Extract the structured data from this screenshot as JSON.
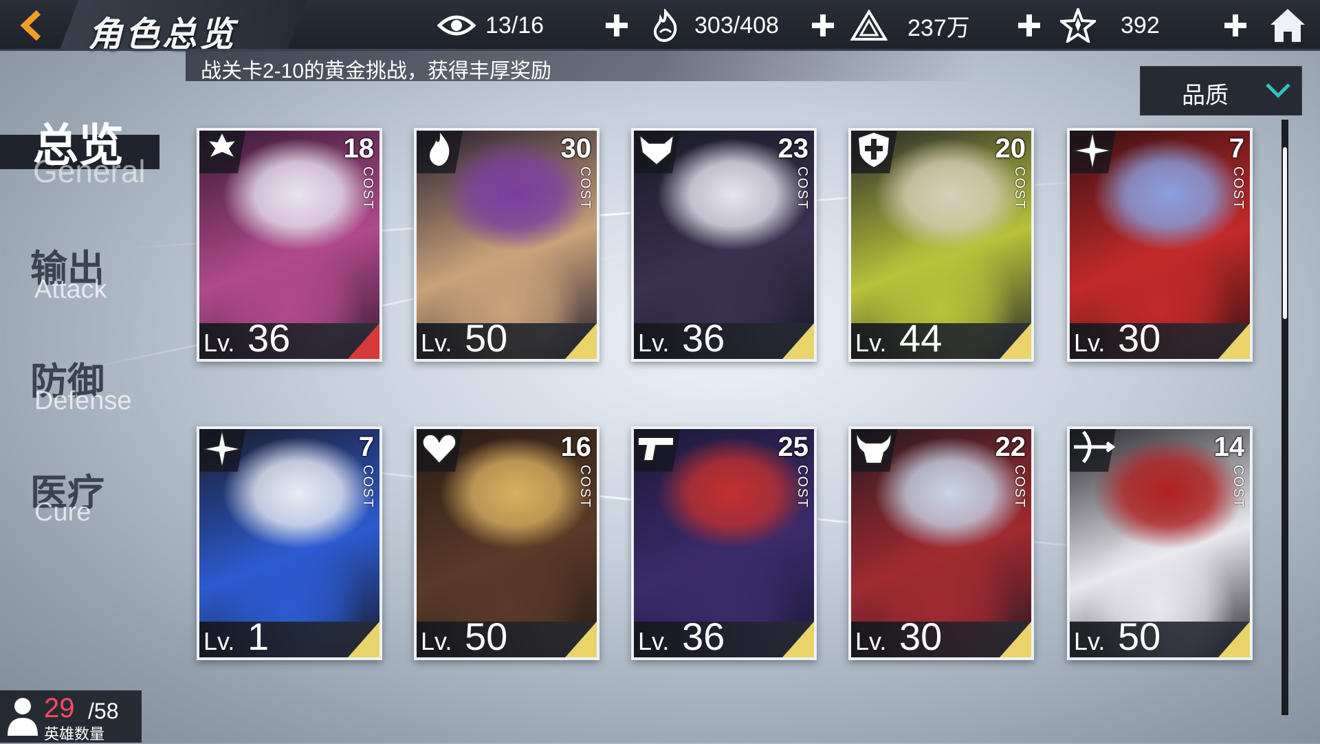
{
  "header": {
    "title": "角色总览",
    "resources": [
      {
        "icon": "eye-icon",
        "value": "13/16"
      },
      {
        "icon": "flame-hand-icon",
        "value": "303/408"
      },
      {
        "icon": "pyramid-coin-icon",
        "value": "237万"
      },
      {
        "icon": "star-crystal-icon",
        "value": "392"
      }
    ]
  },
  "marquee": {
    "text": "战关卡2-10的黄金挑战，获得丰厚奖励"
  },
  "sort": {
    "label": "品质"
  },
  "tabs": [
    {
      "cn": "总览",
      "en": "General",
      "active": true
    },
    {
      "cn": "输出",
      "en": "Attack",
      "active": false
    },
    {
      "cn": "防御",
      "en": "Defense",
      "active": false
    },
    {
      "cn": "医疗",
      "en": "Cure",
      "active": false
    }
  ],
  "cards": [
    {
      "cost": "18",
      "cost_label": "COST",
      "lv_prefix": "Lv.",
      "level": "36",
      "class_icon": "fleur-crest-icon",
      "corner": "red",
      "palette": [
        "#3a1a3a",
        "#b04a8a",
        "#e8e4f0"
      ]
    },
    {
      "cost": "30",
      "cost_label": "COST",
      "lv_prefix": "Lv.",
      "level": "50",
      "class_icon": "flame-crest-icon",
      "corner": "gold",
      "palette": [
        "#2a1f30",
        "#c9a27a",
        "#7b3fa0"
      ]
    },
    {
      "cost": "23",
      "cost_label": "COST",
      "lv_prefix": "Lv.",
      "level": "36",
      "class_icon": "fox-mask-icon",
      "corner": "gold",
      "palette": [
        "#1a1a2a",
        "#3a3050",
        "#e6e6ee"
      ]
    },
    {
      "cost": "20",
      "cost_label": "COST",
      "lv_prefix": "Lv.",
      "level": "44",
      "class_icon": "shield-cross-icon",
      "corner": "gold",
      "palette": [
        "#2a2a2a",
        "#b8c23a",
        "#d8cfb8"
      ]
    },
    {
      "cost": "7",
      "cost_label": "COST",
      "lv_prefix": "Lv.",
      "level": "30",
      "class_icon": "shuriken-icon",
      "corner": "gold",
      "palette": [
        "#3a1010",
        "#c22a2a",
        "#8aa0e0"
      ]
    },
    {
      "cost": "7",
      "cost_label": "COST",
      "lv_prefix": "Lv.",
      "level": "1",
      "class_icon": "shuriken-icon",
      "corner": "gold",
      "palette": [
        "#1a1c2a",
        "#2c5ad0",
        "#e8ecf4"
      ]
    },
    {
      "cost": "16",
      "cost_label": "COST",
      "lv_prefix": "Lv.",
      "level": "50",
      "class_icon": "heart-wing-icon",
      "corner": "gold",
      "palette": [
        "#2a1c14",
        "#5a3a28",
        "#d8b060"
      ]
    },
    {
      "cost": "25",
      "cost_label": "COST",
      "lv_prefix": "Lv.",
      "level": "36",
      "class_icon": "revolver-icon",
      "corner": "gold",
      "palette": [
        "#1e1a3a",
        "#3a2a6a",
        "#c23030"
      ]
    },
    {
      "cost": "22",
      "cost_label": "COST",
      "lv_prefix": "Lv.",
      "level": "30",
      "class_icon": "horned-skull-icon",
      "corner": "gold",
      "palette": [
        "#2a1a20",
        "#a02a30",
        "#c8d4e8"
      ]
    },
    {
      "cost": "14",
      "cost_label": "COST",
      "lv_prefix": "Lv.",
      "level": "50",
      "class_icon": "crossbow-icon",
      "corner": "gold",
      "palette": [
        "#2a2a30",
        "#e8e8ee",
        "#b02020"
      ]
    }
  ],
  "hero_count": {
    "current": "29",
    "max": "/58",
    "label": "英雄数量"
  },
  "colors": {
    "accent_gold": "#e9d36a",
    "accent_red": "#d63a3a",
    "hero_count_red": "#ff4a63",
    "back_arrow": "#f0a020"
  }
}
